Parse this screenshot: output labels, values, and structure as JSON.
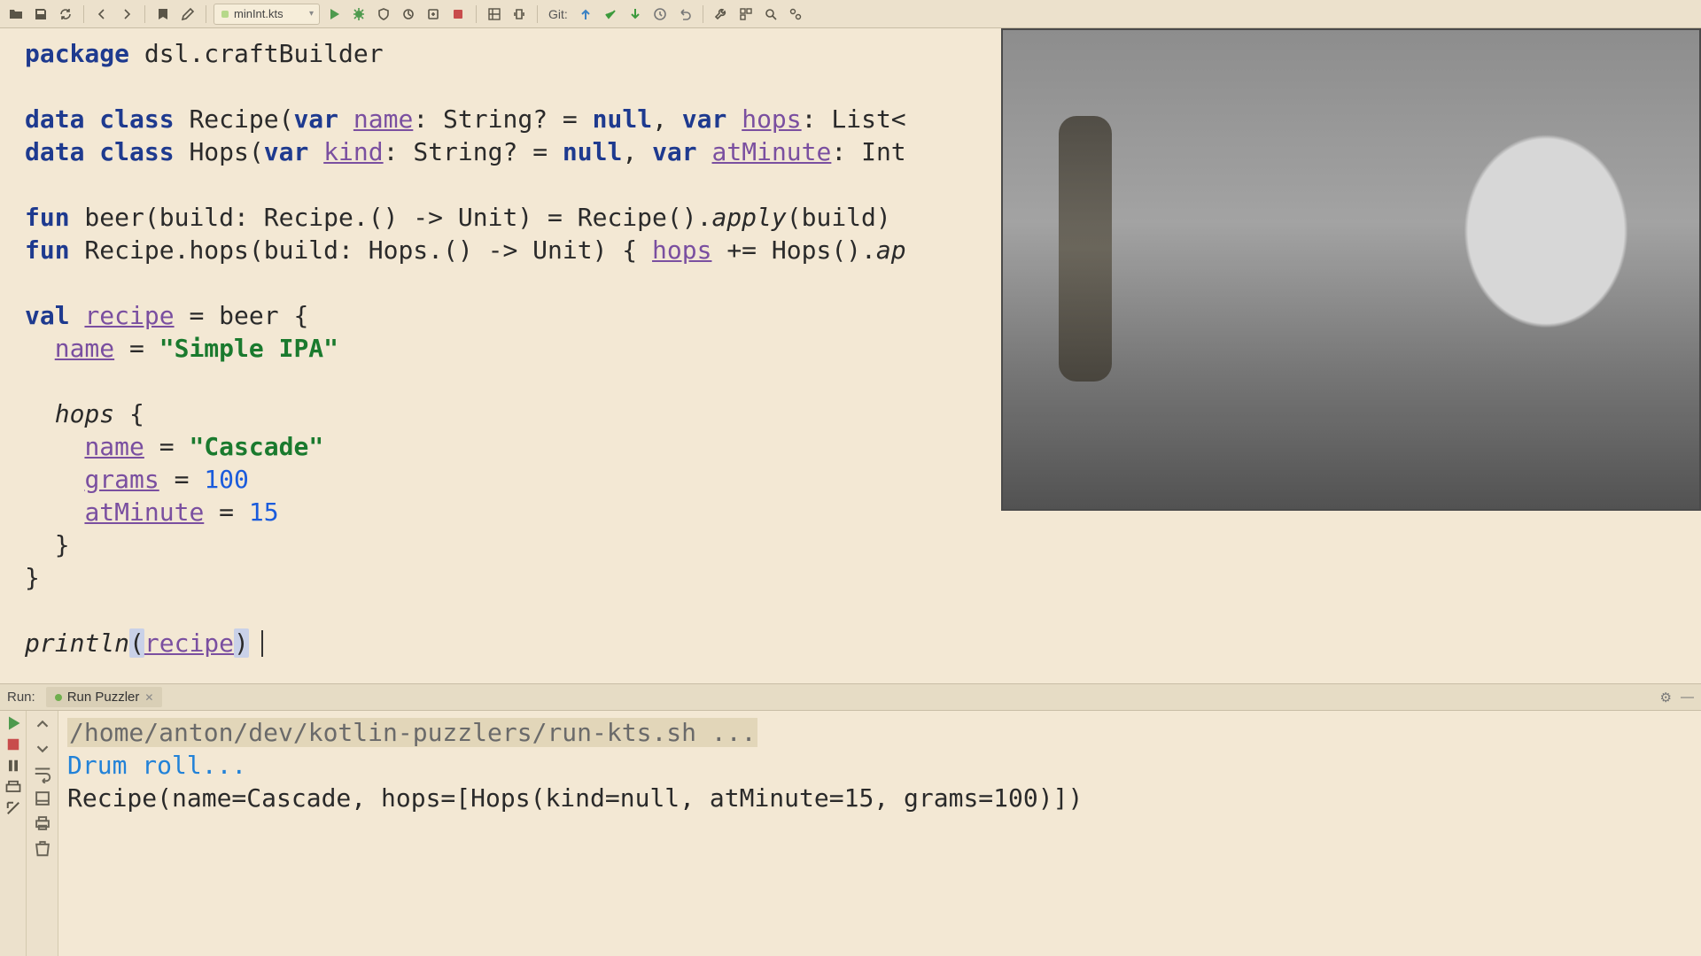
{
  "toolbar": {
    "file_combo": "minInt.kts",
    "git_label": "Git:"
  },
  "code": {
    "kw_package": "package",
    "package_name": " dsl.craftBuilder",
    "kw_data": "data",
    "kw_class": "class",
    "kw_var": "var",
    "kw_fun": "fun",
    "kw_val": "val",
    "recipe_class": " Recipe(",
    "name_prop": "name",
    "string_opt": ": String? = ",
    "null_kw": "null",
    "comma_var": ", ",
    "hops_prop": "hops",
    "list_cut": ": List<",
    "hops_class": " Hops(",
    "kind_prop": "kind",
    "atminute_prop": "atMinute",
    "int_cut": ": Int",
    "beer_sig": " beer(build: Recipe.() -> Unit) = Recipe().",
    "apply": "apply",
    "apply_build": "(build)",
    "recipe_hops_sig": " Recipe.hops(build: Hops.() -> Unit) { ",
    "hops_plus": " += Hops().",
    "ap_cut": "ap",
    "recipe_var": "recipe",
    "eq_beer": " = beer {",
    "name_assign_pad": "  ",
    "eq": " = ",
    "str_ipa": "\"Simple IPA\"",
    "hops_call_pad": "  ",
    "hops_call": "hops",
    "hops_open": " {",
    "inner_pad": "    ",
    "str_cascade": "\"Cascade\"",
    "grams_prop": "grams",
    "num_100": "100",
    "num_15": "15",
    "close_inner": "  }",
    "close_outer": "}",
    "println": "println",
    "lparen": "(",
    "rparen": ")"
  },
  "run": {
    "label": "Run:",
    "tab": "Run Puzzler",
    "cmd": "/home/anton/dev/kotlin-puzzlers/run-kts.sh ...",
    "drum": "Drum roll...",
    "output": "Recipe(name=Cascade, hops=[Hops(kind=null, atMinute=15, grams=100)])"
  }
}
